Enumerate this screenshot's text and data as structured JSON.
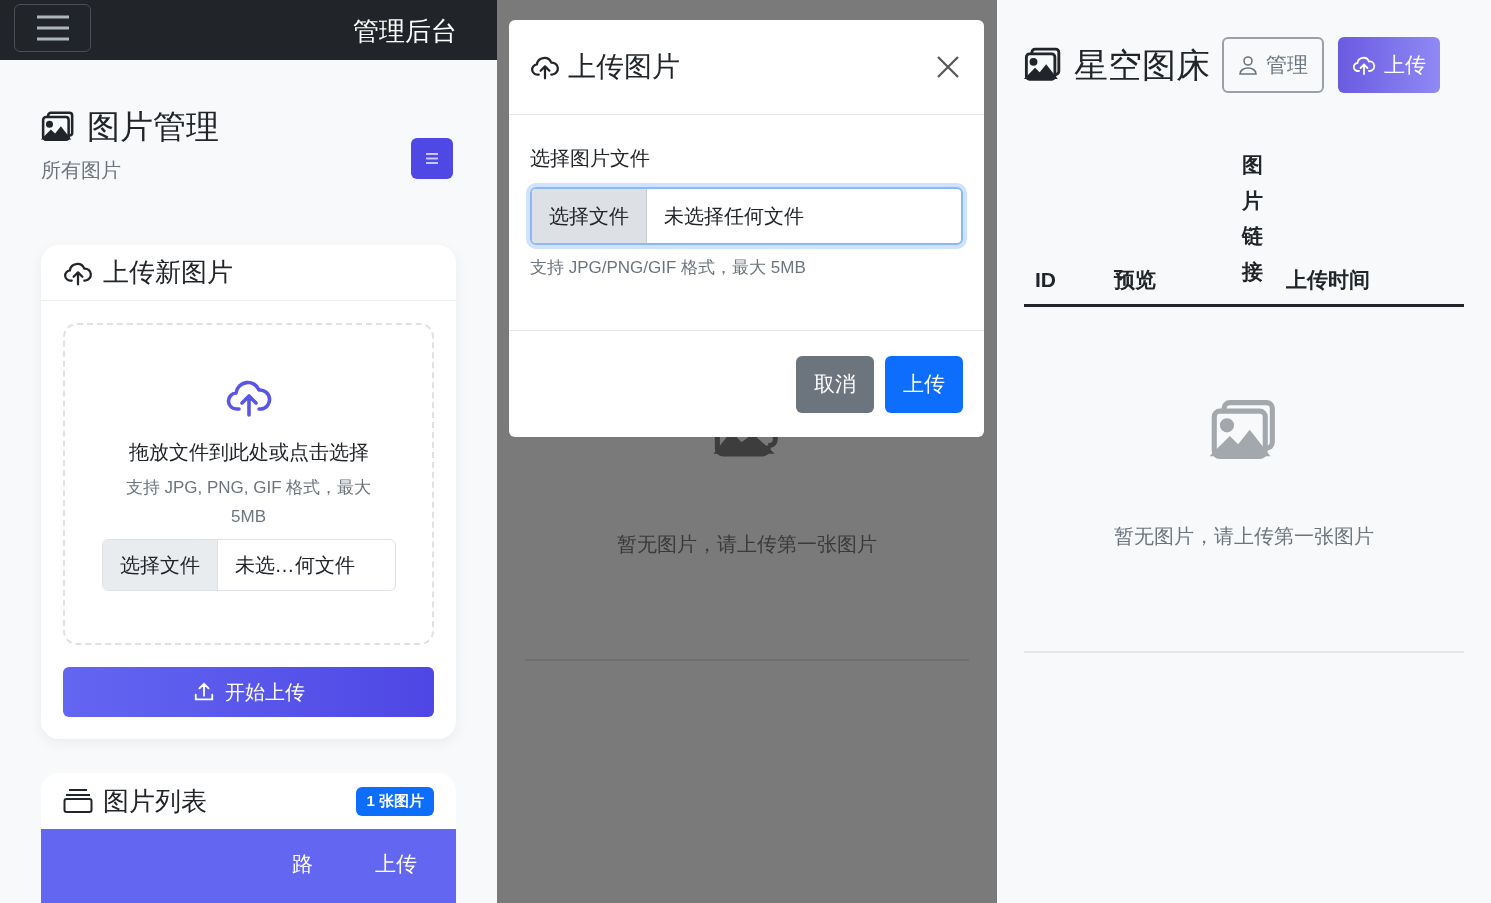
{
  "admin_panel": {
    "navbar": {
      "title": "管理后台"
    },
    "page_header": {
      "title": "图片管理",
      "subtitle": "所有图片"
    },
    "upload_card": {
      "title": "上传新图片",
      "dropzone_text": "拖放文件到此处或点击选择",
      "hint": "支持 JPG, PNG, GIF 格式，最大 5MB",
      "file_button": "选择文件",
      "file_name": "未选…何文件",
      "submit_button": "开始上传"
    },
    "list_card": {
      "title": "图片列表",
      "badge": "1 张图片",
      "columns": [
        "路",
        "上传"
      ]
    }
  },
  "upload_modal": {
    "title": "上传图片",
    "label": "选择图片文件",
    "file_button": "选择文件",
    "file_name": "未选择任何文件",
    "hint": "支持 JPG/PNG/GIF 格式，最大 5MB",
    "buttons": [
      {
        "label": "取消",
        "kind": "secondary"
      },
      {
        "label": "上传",
        "kind": "primary"
      }
    ],
    "background_empty_text": "暂无图片，请上传第一张图片"
  },
  "gallery": {
    "brand": "星空图床",
    "buttons": [
      {
        "label": "管理",
        "kind": "outline"
      },
      {
        "label": "上传",
        "kind": "primary"
      }
    ],
    "columns": [
      {
        "label": "ID",
        "kind": "horizontal"
      },
      {
        "label": "预览",
        "kind": "horizontal"
      },
      {
        "label": "图片链接",
        "kind": "vertical"
      },
      {
        "label": "上传时间",
        "kind": "horizontal"
      }
    ],
    "empty_text": "暂无图片，请上传第一张图片"
  }
}
